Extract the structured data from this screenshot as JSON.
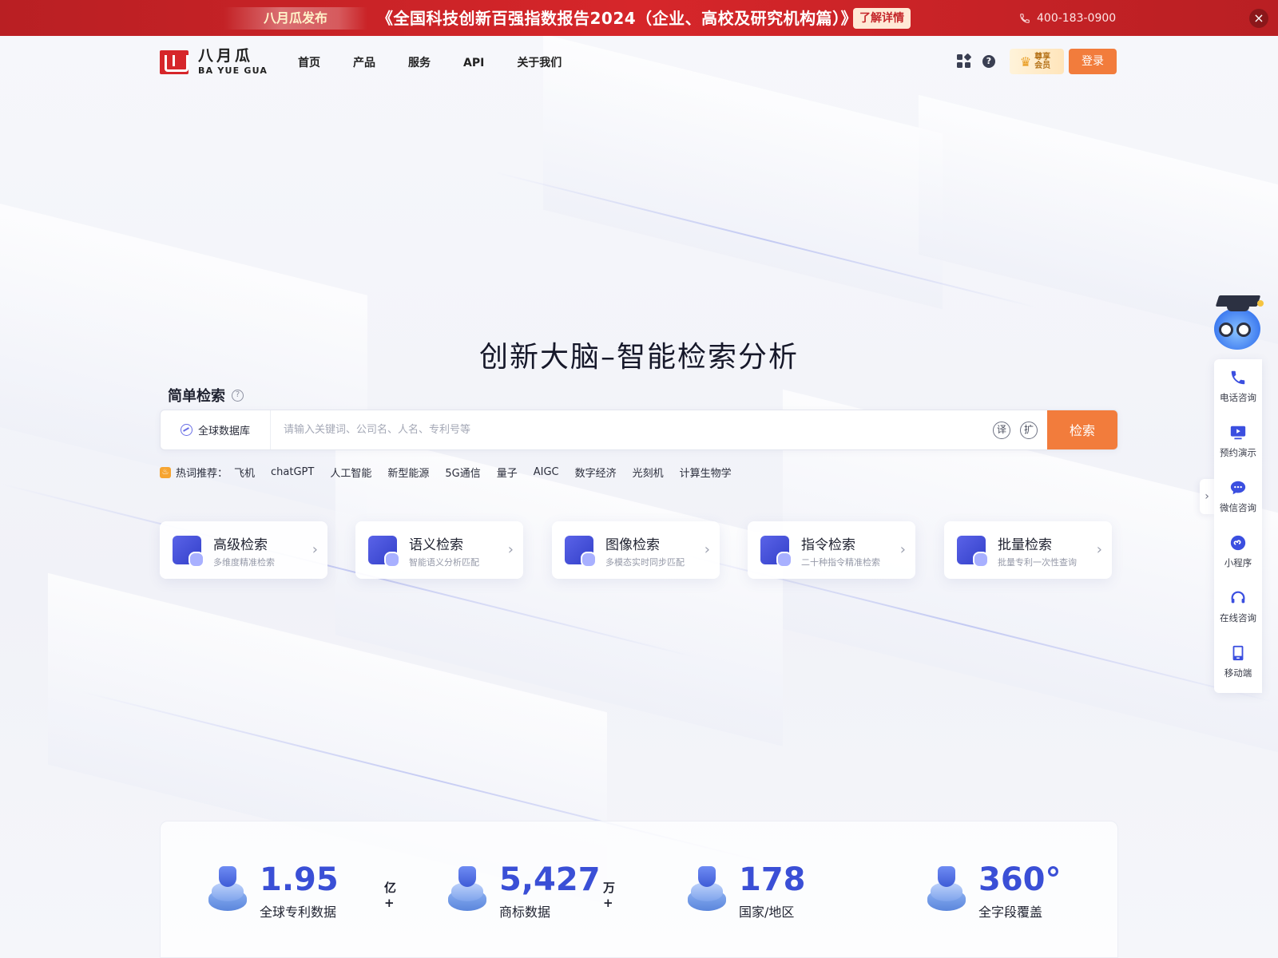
{
  "banner": {
    "tag": "八月瓜发布",
    "headline": "《全国科技创新百强指数报告2024（企业、高校及研究机构篇）》",
    "detail_button": "了解详情",
    "phone": "400-183-0900",
    "close_icon": "close-icon"
  },
  "logo": {
    "name_cn": "八月瓜",
    "name_en": "BA YUE GUA"
  },
  "nav": {
    "items": [
      "首页",
      "产品",
      "服务",
      "API",
      "关于我们"
    ],
    "vip_label": "尊享会员",
    "login_label": "登录"
  },
  "hero": {
    "title": "创新大脑–智能检索分析"
  },
  "search": {
    "mode_label": "简单检索",
    "database_label": "全球数据库",
    "placeholder": "请输入关键词、公司名、人名、专利号等",
    "translate_label": "译",
    "expand_label": "扩",
    "submit_label": "检索"
  },
  "hot": {
    "label": "热词推荐：",
    "keywords": [
      "飞机",
      "chatGPT",
      "人工智能",
      "新型能源",
      "5G通信",
      "量子",
      "AIGC",
      "数字经济",
      "光刻机",
      "计算生物学"
    ]
  },
  "cards": [
    {
      "name": "高级检索",
      "desc": "多维度精准检索",
      "icon": "gear-search-icon"
    },
    {
      "name": "语义检索",
      "desc": "智能语义分析匹配",
      "icon": "semantic-text-icon"
    },
    {
      "name": "图像检索",
      "desc": "多模态实时同步匹配",
      "icon": "image-search-icon"
    },
    {
      "name": "指令检索",
      "desc": "二十种指令精准检索",
      "icon": "code-command-icon"
    },
    {
      "name": "批量检索",
      "desc": "批量专利一次性查询",
      "icon": "batch-grid-icon"
    }
  ],
  "stats": [
    {
      "value": "1.95",
      "unit": "亿+",
      "label": "全球专利数据"
    },
    {
      "value": "5,427",
      "unit": "万+",
      "label": "商标数据"
    },
    {
      "value": "178",
      "unit": "",
      "label": "国家/地区"
    },
    {
      "value": "360°",
      "unit": "",
      "label": "全字段覆盖"
    }
  ],
  "sidebar": {
    "items": [
      {
        "label": "电话咨询",
        "icon": "phone-icon"
      },
      {
        "label": "预约演示",
        "icon": "monitor-play-icon"
      },
      {
        "label": "微信咨询",
        "icon": "chat-bubble-icon"
      },
      {
        "label": "小程序",
        "icon": "mini-program-icon"
      },
      {
        "label": "在线咨询",
        "icon": "headset-icon"
      },
      {
        "label": "移动端",
        "icon": "mobile-icon"
      }
    ]
  },
  "colors": {
    "banner_red": "#d6262a",
    "accent_orange": "#f27c3c",
    "brand_blue": "#3a4fd6"
  }
}
